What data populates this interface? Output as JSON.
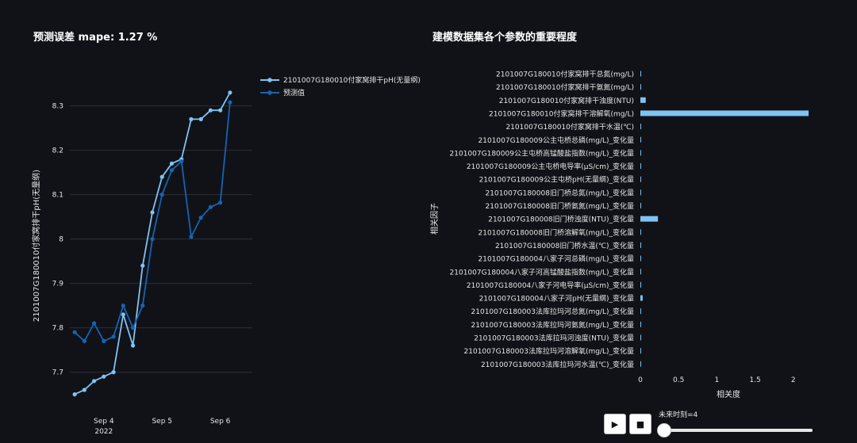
{
  "left_title": "预测误差 mape: 1.27 %",
  "right_title": "建模数据集各个参数的重要程度",
  "controls": {
    "play_icon": "▶",
    "stop_icon": "■",
    "slider_label": "未来时刻=4",
    "slider_value": 4
  },
  "chart_data": [
    {
      "type": "line",
      "ylabel": "2101007G180010付家窝排干pH(无量纲)",
      "ylim": [
        7.61,
        8.36
      ],
      "y_ticks": [
        7.7,
        7.8,
        7.9,
        8,
        8.1,
        8.2,
        8.3
      ],
      "y_tick_labels": [
        "7.7",
        "7.8",
        "7.9",
        "8",
        "8.1",
        "8.2",
        "8.3"
      ],
      "x_ticks": [
        {
          "label": "Sep 4",
          "sub": "2022",
          "x": 3
        },
        {
          "label": "Sep 5",
          "sub": "",
          "x": 9
        },
        {
          "label": "Sep 6",
          "sub": "",
          "x": 15
        }
      ],
      "xlim": [
        -0.5,
        18.3
      ],
      "legend_position": "top-right",
      "series": [
        {
          "name": "2101007G180010付家窝排干pH(无量纲)",
          "color": "#7ec3f4",
          "values": [
            7.65,
            7.66,
            7.68,
            7.69,
            7.7,
            7.83,
            7.76,
            7.94,
            8.06,
            8.14,
            8.17,
            8.18,
            8.27,
            8.27,
            8.29,
            8.29,
            8.33
          ]
        },
        {
          "name": "预测值",
          "color": "#1464b4",
          "values": [
            7.79,
            7.77,
            7.81,
            7.77,
            7.78,
            7.85,
            7.8,
            7.85,
            8.0,
            8.1,
            8.155,
            8.175,
            8.005,
            8.048,
            8.072,
            8.082,
            8.308
          ]
        }
      ]
    },
    {
      "type": "bar",
      "orientation": "horizontal",
      "ylabel": "相关因子",
      "xlabel": "相关度",
      "xlim": [
        0,
        2.2
      ],
      "x_ticks": [
        0,
        0.5,
        1,
        1.5,
        2
      ],
      "x_tick_labels": [
        "0",
        "0.5",
        "1",
        "1.5",
        "2"
      ],
      "color": "#7ec3f4",
      "categories": [
        "2101007G180010付家窝排干总氮(mg/L)",
        "2101007G180010付家窝排干氨氮(mg/L)",
        "2101007G180010付家窝排干浊度(NTU)",
        "2101007G180010付家窝排干溶解氧(mg/L)",
        "2101007G180010付家窝排干水温(℃)",
        "2101007G180009公主屯桥总磷(mg/L)_变化量",
        "2101007G180009公主屯桥高锰酸盐指数(mg/L)_变化量",
        "2101007G180009公主屯桥电导率(μS/cm)_变化量",
        "2101007G180009公主屯桥pH(无量纲)_变化量",
        "2101007G180008旧门桥总氮(mg/L)_变化量",
        "2101007G180008旧门桥氨氮(mg/L)_变化量",
        "2101007G180008旧门桥浊度(NTU)_变化量",
        "2101007G180008旧门桥溶解氧(mg/L)_变化量",
        "2101007G180008旧门桥水温(℃)_变化量",
        "2101007G180004八家子河总磷(mg/L)_变化量",
        "2101007G180004八家子河高锰酸盐指数(mg/L)_变化量",
        "2101007G180004八家子河电导率(μS/cm)_变化量",
        "2101007G180004八家子河pH(无量纲)_变化量",
        "2101007G180003法库拉玛河总氮(mg/L)_变化量",
        "2101007G180003法库拉玛河氨氮(mg/L)_变化量",
        "2101007G180003法库拉玛河浊度(NTU)_变化量",
        "2101007G180003法库拉玛河溶解氧(mg/L)_变化量",
        "2101007G180003法库拉玛河水温(℃)_变化量"
      ],
      "values": [
        0.01,
        0.01,
        0.07,
        2.2,
        0.01,
        0.01,
        0.005,
        0.005,
        0.005,
        0.005,
        0.005,
        0.23,
        0.005,
        0.005,
        0.005,
        0.005,
        0.01,
        0.03,
        0.005,
        0.005,
        0.005,
        0.005,
        0.005
      ]
    }
  ]
}
